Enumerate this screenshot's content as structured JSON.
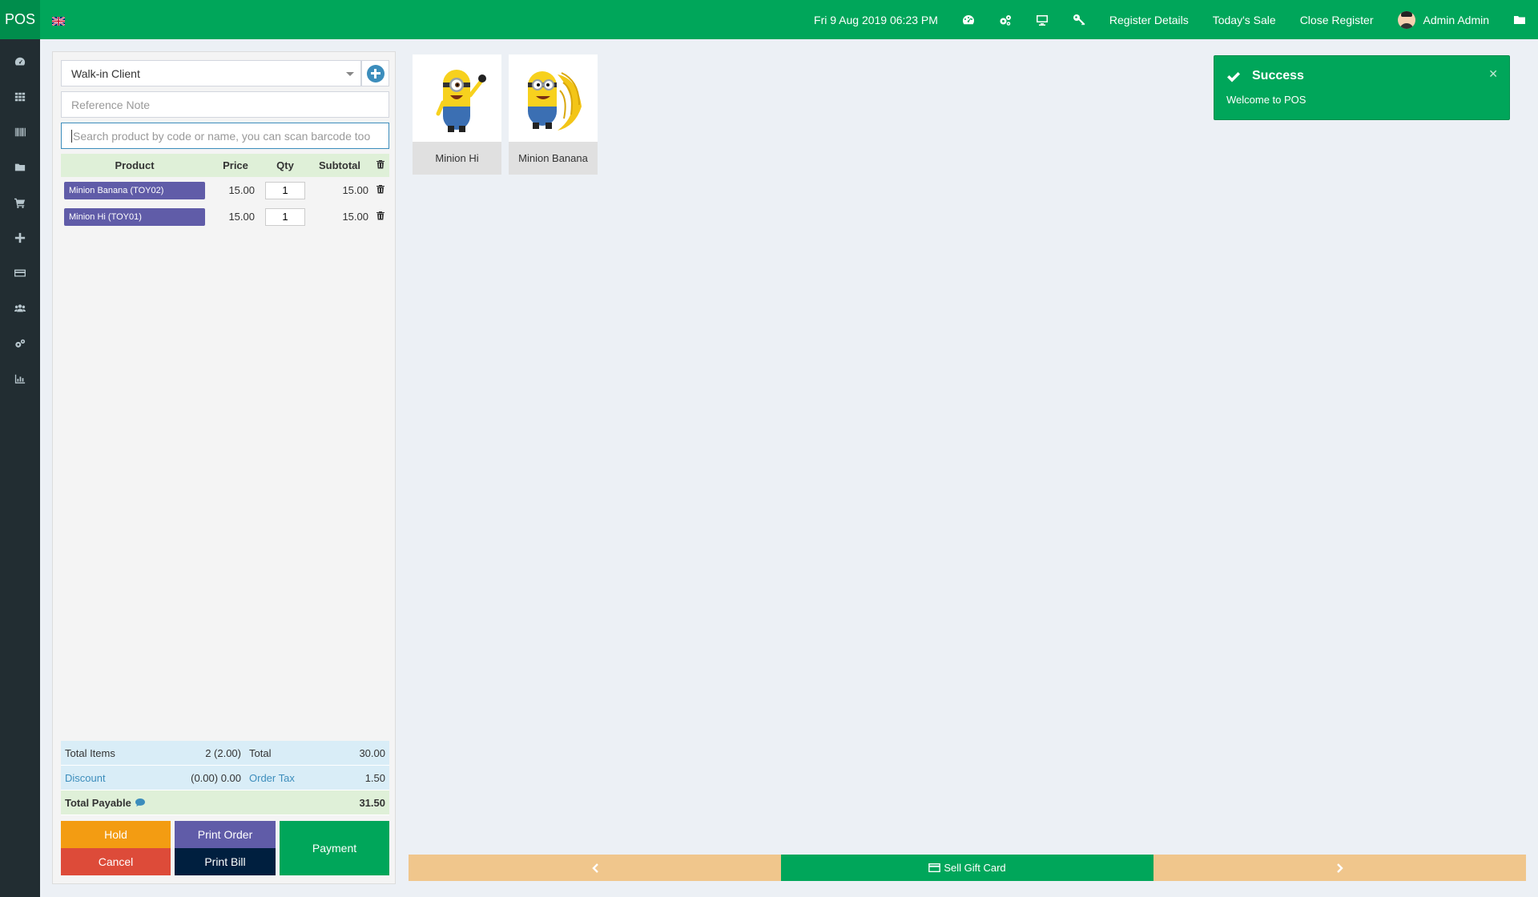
{
  "topbar": {
    "logo": "POS",
    "datetime": "Fri 9 Aug 2019 06:23 PM",
    "register_details": "Register Details",
    "todays_sale": "Today's Sale",
    "close_register": "Close Register",
    "user_name": "Admin Admin",
    "color": "#00a65a"
  },
  "sidebar": {
    "icons": [
      "dashboard-icon",
      "grid-icon",
      "barcode-icon",
      "folder-icon",
      "cart-icon",
      "plus-icon",
      "credit-card-icon",
      "users-icon",
      "gears-icon",
      "bar-chart-icon"
    ]
  },
  "order": {
    "client": "Walk-in Client",
    "reference_placeholder": "Reference Note",
    "search_placeholder": "Search product by code or name, you can scan barcode too",
    "headers": {
      "product": "Product",
      "price": "Price",
      "qty": "Qty",
      "subtotal": "Subtotal"
    },
    "items": [
      {
        "product": "Minion Banana (TOY02)",
        "price": "15.00",
        "qty": "1",
        "subtotal": "15.00"
      },
      {
        "product": "Minion Hi (TOY01)",
        "price": "15.00",
        "qty": "1",
        "subtotal": "15.00"
      }
    ]
  },
  "totals": {
    "total_items_label": "Total Items",
    "total_items_value": "2 (2.00)",
    "total_label": "Total",
    "total_value": "30.00",
    "discount_label": "Discount",
    "discount_value": "(0.00) 0.00",
    "order_tax_label": "Order Tax",
    "order_tax_value": "1.50",
    "total_payable_label": "Total Payable",
    "total_payable_value": "31.50"
  },
  "buttons": {
    "hold": "Hold",
    "print_order": "Print Order",
    "cancel": "Cancel",
    "print_bill": "Print Bill",
    "payment": "Payment",
    "colors": {
      "hold": "#f39c12",
      "print_order": "#605ca8",
      "cancel": "#dd4b39",
      "print_bill": "#001f3f",
      "payment": "#00a65a"
    }
  },
  "products": [
    {
      "name": "Minion Hi"
    },
    {
      "name": "Minion Banana"
    }
  ],
  "toast": {
    "title": "Success",
    "message": "Welcome to POS"
  },
  "bottom_bar": {
    "sell_gift_card": "Sell Gift Card",
    "nav_color": "#f0c68c"
  }
}
